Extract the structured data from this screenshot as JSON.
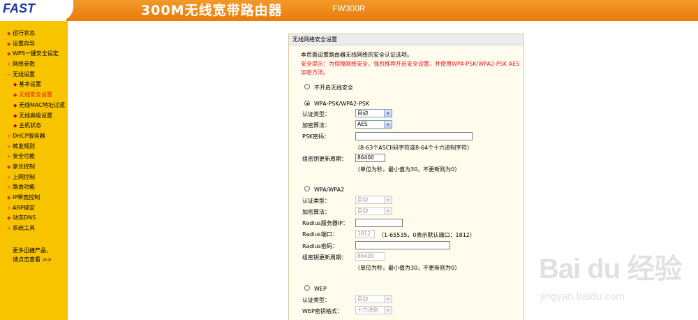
{
  "header": {
    "logo": "FAST",
    "title": "300M无线宽带路由器",
    "model": "FW300R"
  },
  "sidebar": {
    "items": [
      {
        "label": "运行状态",
        "bullet": "◆"
      },
      {
        "label": "设置向导",
        "bullet": "◆"
      },
      {
        "label": "WPS一键安全设定",
        "bullet": "◆"
      },
      {
        "label": "网络参数",
        "bullet": "+"
      },
      {
        "label": "无线设置",
        "bullet": "−"
      },
      {
        "label": "基本设置",
        "bullet": "◆"
      },
      {
        "label": "无线安全设置",
        "bullet": "◆"
      },
      {
        "label": "无线MAC地址过滤",
        "bullet": "◆"
      },
      {
        "label": "无线高级设置",
        "bullet": "◆"
      },
      {
        "label": "主机状态",
        "bullet": "◆"
      },
      {
        "label": "DHCP服务器",
        "bullet": "+"
      },
      {
        "label": "转发规则",
        "bullet": "+"
      },
      {
        "label": "安全功能",
        "bullet": "+"
      },
      {
        "label": "家长控制",
        "bullet": "◆"
      },
      {
        "label": "上网控制",
        "bullet": "+"
      },
      {
        "label": "路由功能",
        "bullet": "+"
      },
      {
        "label": "IP带宽控制",
        "bullet": "◆"
      },
      {
        "label": "ARP绑定",
        "bullet": "+"
      },
      {
        "label": "动态DNS",
        "bullet": "◆"
      },
      {
        "label": "系统工具",
        "bullet": "+"
      }
    ],
    "more_line1": "更多迅捷产品，",
    "more_line2": "请点击查看 >>"
  },
  "panel": {
    "title": "无线网络安全设置",
    "intro": "本页面设置路由器无线网络的安全认证选项。",
    "tip_line1": "安全提示：为保障网络安全，强烈推荐开启安全设置，并使用WPA-PSK/WPA2-PSK AES",
    "tip_line2": "加密方法。",
    "opt_off": "不开启无线安全",
    "opt_psk": "WPA-PSK/WPA2-PSK",
    "psk": {
      "auth_label": "认证类型：",
      "auth_value": "自动",
      "enc_label": "加密算法：",
      "enc_value": "AES",
      "key_label": "PSK密码：",
      "key_value": "",
      "key_hint": "（8-63个ASCII码字符或8-64个十六进制字符）",
      "period_label": "组密钥更新周期：",
      "period_value": "86400",
      "period_hint": "（单位为秒，最小值为30，不更新则为0）"
    },
    "opt_wpa": "WPA/WPA2",
    "wpa": {
      "auth_label": "认证类型：",
      "auth_value": "自动",
      "enc_label": "加密算法：",
      "enc_value": "自动",
      "ip_label": "Radius服务器IP：",
      "ip_value": "",
      "port_label": "Radius端口：",
      "port_value": "1812",
      "port_hint": "（1-65535，0表示默认端口：1812）",
      "pwd_label": "Radius密码：",
      "pwd_value": "",
      "period_label": "组密钥更新周期：",
      "period_value": "86400",
      "period_hint": "（单位为秒，最小值为30，不更新则为0）"
    },
    "opt_wep": "WEP",
    "wep": {
      "auth_label": "认证类型：",
      "auth_value": "自动",
      "fmt_label": "WEP密钥格式：",
      "fmt_value": "十六进制"
    }
  },
  "watermark": {
    "brand": "Bai du 经验",
    "url": "jingyan.baidu.com"
  },
  "colors": {
    "header": "#f08a1a",
    "sidebar": "#f8c400",
    "active_menu": "#e4161b",
    "warning_text": "#e4161b",
    "panel_bg": "#fffced"
  }
}
